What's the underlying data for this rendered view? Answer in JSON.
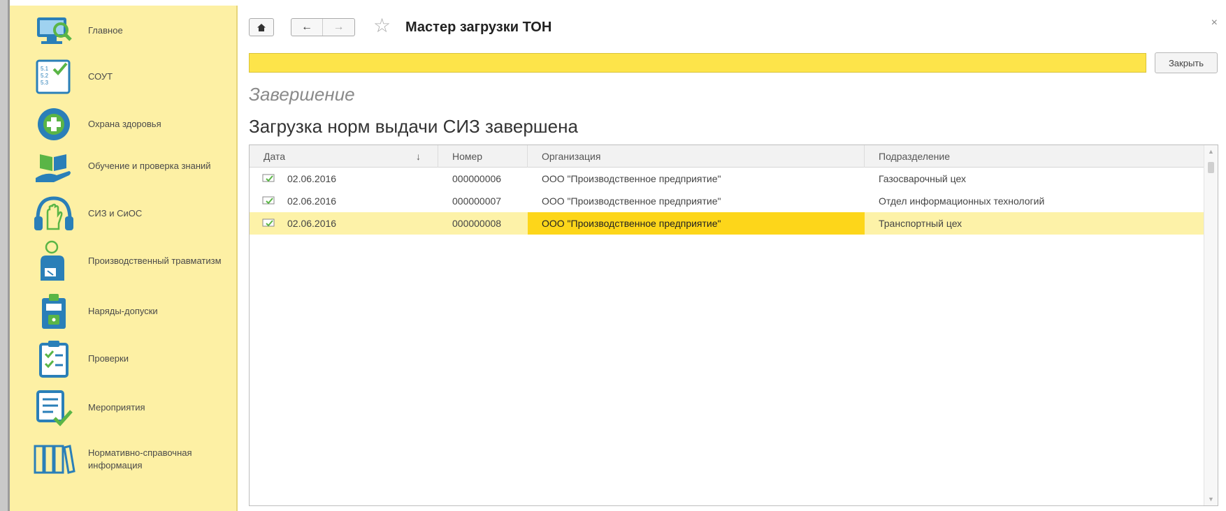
{
  "sidebar": {
    "items": [
      {
        "label": "Главное",
        "icon": "monitor-search-icon"
      },
      {
        "label": "СОУТ",
        "icon": "checklist-icon"
      },
      {
        "label": "Охрана здоровья",
        "icon": "medical-cross-icon"
      },
      {
        "label": "Обучение и проверка знаний",
        "icon": "book-hand-icon"
      },
      {
        "label": "СИЗ и СиОС",
        "icon": "glove-headphones-icon"
      },
      {
        "label": "Производственный травматизм",
        "icon": "injured-person-icon"
      },
      {
        "label": "Наряды-допуски",
        "icon": "clipboard-lock-icon"
      },
      {
        "label": "Проверки",
        "icon": "clipboard-check-icon"
      },
      {
        "label": "Мероприятия",
        "icon": "list-check-icon"
      },
      {
        "label": "Нормативно-справочная информация",
        "icon": "binders-icon"
      }
    ]
  },
  "header": {
    "title": "Мастер загрузки ТОН",
    "close_symbol": "×"
  },
  "progress": {
    "value": 1.0,
    "color": "#fde44a"
  },
  "close_button_label": "Закрыть",
  "subtitle": "Завершение",
  "heading": "Загрузка норм выдачи СИЗ завершена",
  "table": {
    "columns": [
      "Дата",
      "Номер",
      "Организация",
      "Подразделение"
    ],
    "sort_indicator": "↓",
    "rows": [
      {
        "date": "02.06.2016",
        "number": "000000006",
        "org": "ООО \"Производственное предприятие\"",
        "dept": "Газосварочный цех"
      },
      {
        "date": "02.06.2016",
        "number": "000000007",
        "org": "ООО \"Производственное предприятие\"",
        "dept": "Отдел информационных технологий"
      },
      {
        "date": "02.06.2016",
        "number": "000000008",
        "org": "ООО \"Производственное предприятие\"",
        "dept": "Транспортный цех"
      }
    ],
    "selected_row": 2
  },
  "colors": {
    "sidebar_bg": "#fdf0a4",
    "accent_yellow": "#fdd61a",
    "icon_blue": "#2a7fb8",
    "icon_green": "#5ab546"
  }
}
